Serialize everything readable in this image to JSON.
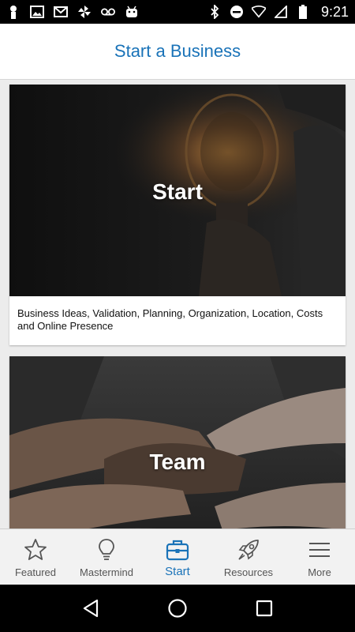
{
  "status_bar": {
    "time": "9:21",
    "left_icons": [
      "person-icon",
      "image-icon",
      "gmail-icon",
      "pinwheel-icon",
      "voicemail-icon",
      "android-icon"
    ],
    "right_icons": [
      "bluetooth-icon",
      "do-not-disturb-icon",
      "wifi-icon",
      "signal-icon",
      "battery-icon"
    ]
  },
  "header": {
    "title": "Start a Business"
  },
  "cards": [
    {
      "title": "Start",
      "description": "Business Ideas, Validation, Planning, Organization, Location, Costs and Online Presence"
    },
    {
      "title": "Team",
      "description": ""
    }
  ],
  "tabs": [
    {
      "label": "Featured",
      "icon": "star-icon",
      "active": false
    },
    {
      "label": "Mastermind",
      "icon": "lightbulb-icon",
      "active": false
    },
    {
      "label": "Start",
      "icon": "briefcase-icon",
      "active": true
    },
    {
      "label": "Resources",
      "icon": "rocket-icon",
      "active": false
    },
    {
      "label": "More",
      "icon": "menu-icon",
      "active": false
    }
  ],
  "colors": {
    "accent": "#1a73b8",
    "tab_inactive": "#555555"
  }
}
